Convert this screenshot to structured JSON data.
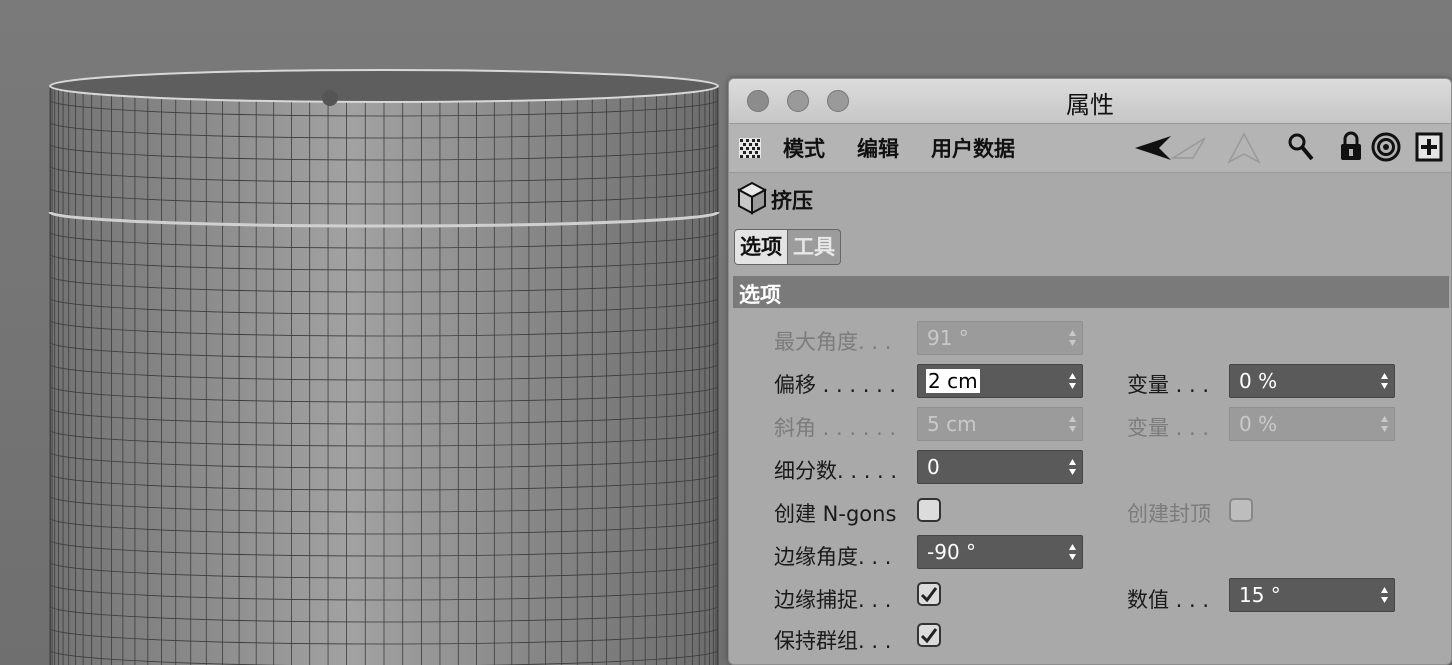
{
  "window": {
    "title": "属性"
  },
  "menu": {
    "items": [
      "模式",
      "编辑",
      "用户数据"
    ]
  },
  "object": {
    "name": "挤压",
    "icon": "cube-icon"
  },
  "tabs": [
    {
      "label": "选项",
      "active": true
    },
    {
      "label": "工具",
      "active": false
    }
  ],
  "section": {
    "title": "选项"
  },
  "fields": {
    "max_angle": {
      "label": "最大角度. . .",
      "value": "91 °",
      "enabled": false
    },
    "offset": {
      "label": "偏移 . . . . . .",
      "value": "2 cm",
      "enabled": true
    },
    "offset_var": {
      "label": "变量 . . .",
      "value": "0 %",
      "enabled": true
    },
    "bevel": {
      "label": "斜角 . . . . . .",
      "value": "5 cm",
      "enabled": false
    },
    "bevel_var": {
      "label": "变量 . . .",
      "value": "0 %",
      "enabled": false
    },
    "subdiv": {
      "label": "细分数. . . . .",
      "value": "0",
      "enabled": true
    },
    "ngons": {
      "label": "创建 N-gons",
      "checked": false
    },
    "caps": {
      "label": "创建封顶",
      "checked": false,
      "enabled": false
    },
    "edge_angle": {
      "label": "边缘角度. . .",
      "value": "-90 °",
      "enabled": true
    },
    "edge_snap": {
      "label": "边缘捕捉. . .",
      "checked": true
    },
    "snap_value": {
      "label": "数值 . . .",
      "value": "15 °",
      "enabled": true
    },
    "keep_groups": {
      "label": "保持群组. . .",
      "checked": true
    }
  },
  "colors": {
    "panel": "#a9a9a9",
    "field": "#5a5a5a",
    "section": "#7a7a7a"
  }
}
